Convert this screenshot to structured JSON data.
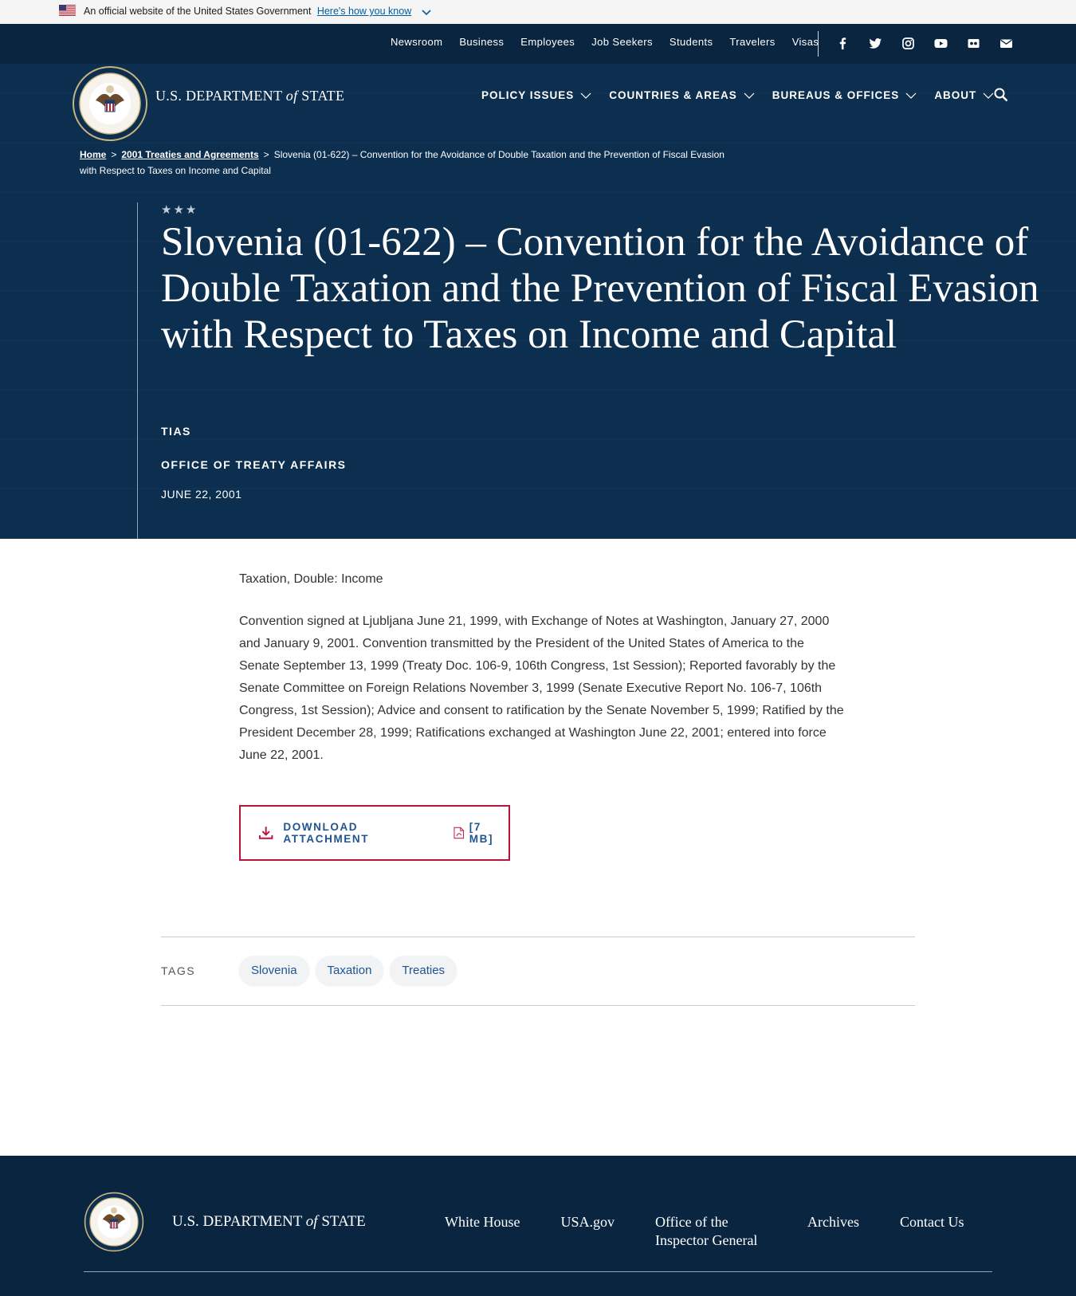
{
  "gov_banner": {
    "text": "An official website of the United States Government",
    "link": "Here's how you know"
  },
  "utility_nav": [
    "Newsroom",
    "Business",
    "Employees",
    "Job Seekers",
    "Students",
    "Travelers",
    "Visas"
  ],
  "social_icons": [
    "facebook-icon",
    "twitter-icon",
    "instagram-icon",
    "youtube-icon",
    "flickr-icon",
    "email-icon"
  ],
  "header": {
    "dept_prefix": "U.S. DEPARTMENT",
    "dept_of": "of",
    "dept_suffix": "STATE"
  },
  "main_nav": [
    "POLICY ISSUES",
    "COUNTRIES & AREAS",
    "BUREAUS & OFFICES",
    "ABOUT"
  ],
  "breadcrumb": {
    "home": "Home",
    "parent": "2001 Treaties and Agreements",
    "sep": ">",
    "current": "Slovenia (01-622) – Convention for the Avoidance of Double Taxation and the Prevention of Fiscal Evasion with Respect to Taxes on Income and Capital"
  },
  "article": {
    "stars": "★★★",
    "title": "Slovenia (01-622) – Convention for the Avoidance of Double Taxation and the Prevention of Fiscal Evasion with Respect to Taxes on Income and Capital",
    "bureau": "TIAS",
    "office": "OFFICE OF TREATY AFFAIRS",
    "date": "JUNE 22, 2001",
    "subject": "Taxation, Double: Income",
    "summary": "Convention signed at Ljubljana June 21, 1999, with Exchange of Notes at Washington, January 27, 2000 and January 9, 2001.  Convention transmitted by the President of the United States of America to the Senate September 13, 1999 (Treaty Doc. 106-9, 106th Congress, 1st Session); Reported favorably by the Senate Committee on Foreign Relations November 3, 1999 (Senate Executive Report No. 106-7, 106th Congress, 1st Session); Advice and consent to ratification by the Senate November 5, 1999;  Ratified by the President December 28, 1999; Ratifications exchanged at Washington June 22, 2001; entered into force June 22, 2001."
  },
  "download": {
    "label": "DOWNLOAD ATTACHMENT",
    "size": "[7 MB]"
  },
  "tags": {
    "label": "TAGS",
    "items": [
      "Slovenia",
      "Taxation",
      "Treaties"
    ]
  },
  "footer": {
    "dept_prefix": "U.S. DEPARTMENT",
    "dept_of": "of",
    "dept_suffix": "STATE",
    "links": [
      "White House",
      "USA.gov",
      "Office of the Inspector General",
      "Archives",
      "Contact Us"
    ]
  },
  "colors": {
    "navy": "#0c2e4f",
    "utility_navy": "#0a2540",
    "link_blue": "#205493",
    "accent_red": "#bb133e"
  }
}
